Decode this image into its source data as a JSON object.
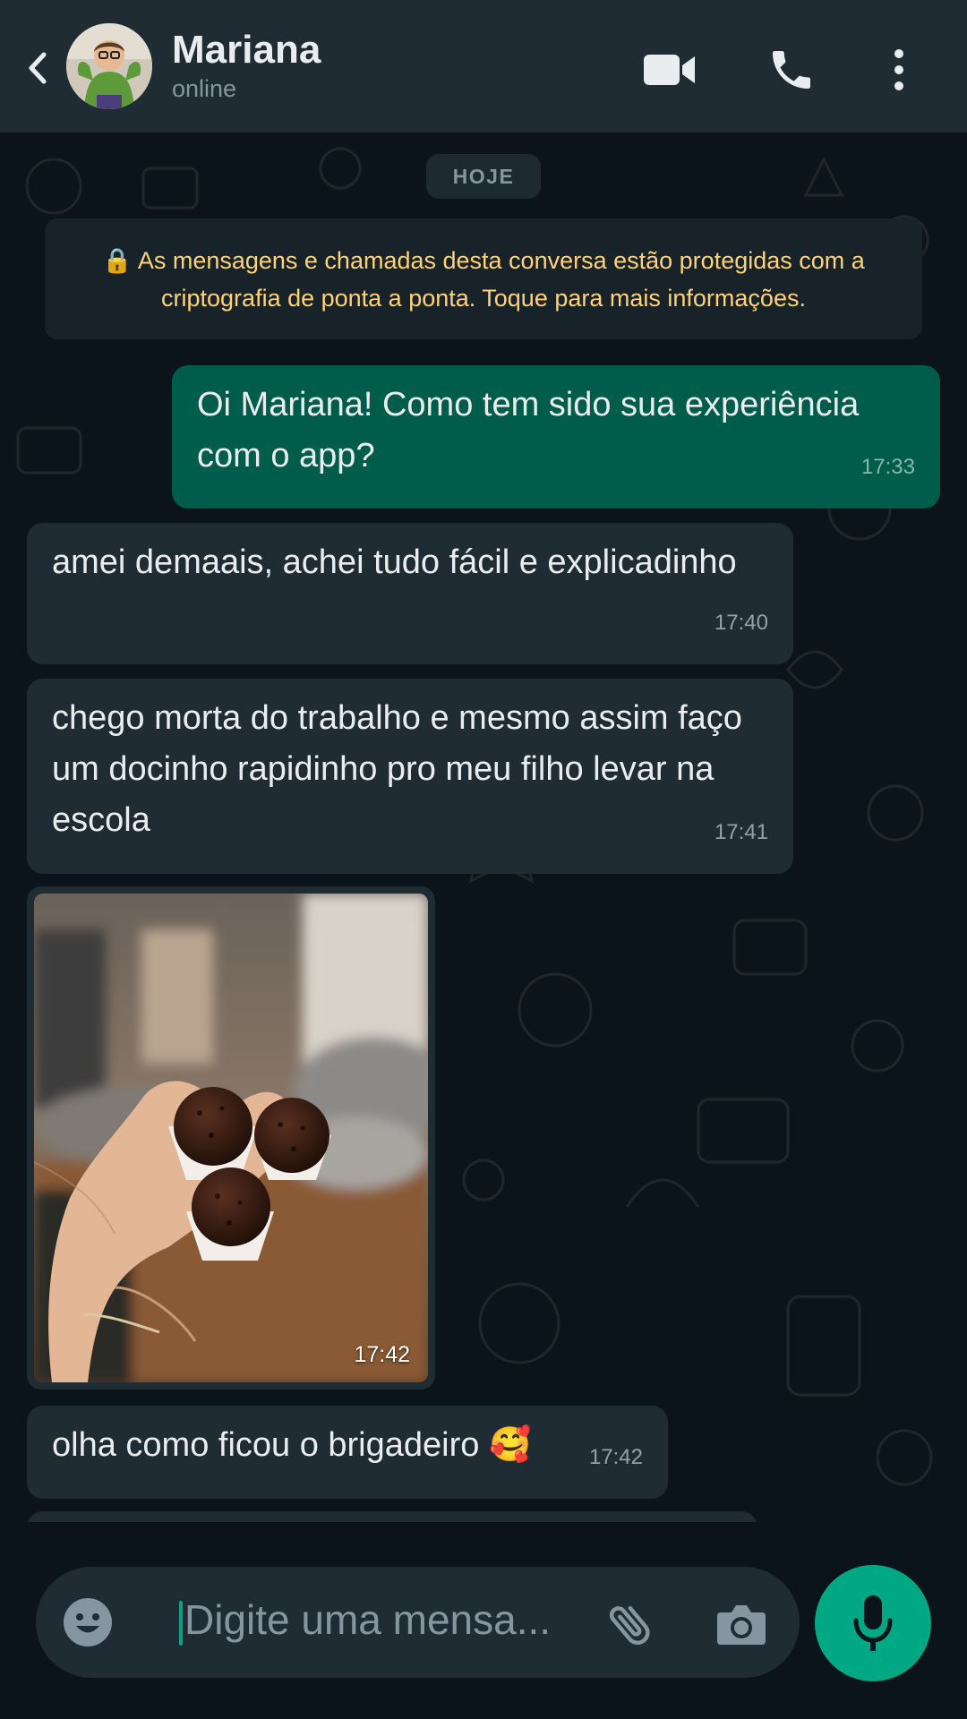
{
  "header": {
    "contact_name": "Mariana",
    "contact_status": "online",
    "icons": [
      "back-arrow-icon",
      "video-call-icon",
      "phone-icon",
      "more-vertical-icon"
    ]
  },
  "chat": {
    "day_label": "HOJE",
    "encryption_notice": "🔒 As mensagens e chamadas desta conversa estão protegidas com a criptografia de ponta a ponta. Toque para mais informações.",
    "messages": [
      {
        "direction": "out",
        "text": "Oi Mariana! Como tem sido sua experiência com o app?",
        "time": "17:33"
      },
      {
        "direction": "in",
        "text": "amei demaais, achei tudo fácil e explicadinho",
        "time": "17:40"
      },
      {
        "direction": "in",
        "text": "chego morta do trabalho e mesmo assim faço um docinho rapidinho pro meu filho levar na escola",
        "time": "17:41"
      },
      {
        "direction": "in",
        "type": "image",
        "image_subject": "brigadeiros on a hand",
        "time": "17:42"
      },
      {
        "direction": "in",
        "text": "olha como ficou o brigadeiro 🥰",
        "time": "17:42"
      }
    ]
  },
  "composer": {
    "placeholder": "Digite uma mensa...",
    "icons": [
      "emoji-icon",
      "attach-icon",
      "camera-icon",
      "microphone-icon"
    ]
  },
  "colors": {
    "header_bg": "#1f2c34",
    "chat_bg": "#0b141a",
    "incoming_bubble": "#1f2c34",
    "outgoing_bubble": "#005c4b",
    "accent": "#00a884",
    "encryption_text": "#ffd279"
  }
}
